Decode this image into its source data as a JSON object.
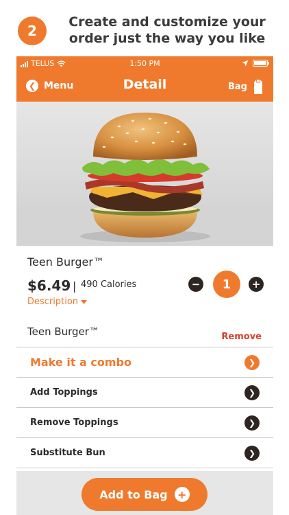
{
  "promo": {
    "step_number": "2",
    "title_line1": "Create and customize your",
    "title_line2": "order just the way you like"
  },
  "status_bar": {
    "carrier": "TELUS",
    "time": "1:50 PM"
  },
  "nav": {
    "back_label": "Menu",
    "title": "Detail",
    "bag_label": "Bag"
  },
  "product": {
    "name": "Teen Burger™",
    "price": "$6.49",
    "separator": "|",
    "calories": "490 Calories",
    "description_label": "Description",
    "quantity": "1"
  },
  "items": [
    {
      "name": "Teen Burger™",
      "remove_label": "Remove"
    }
  ],
  "options": [
    {
      "label": "Make it a combo",
      "accent": true
    },
    {
      "label": "Add Toppings"
    },
    {
      "label": "Remove Toppings"
    },
    {
      "label": "Substitute Bun"
    }
  ],
  "footer": {
    "add_button_label": "Add to Bag"
  },
  "colors": {
    "accent": "#ef7a2e",
    "dark": "#2e2420",
    "remove": "#d5402b"
  },
  "icons": [
    "signal-bars-icon",
    "wifi-icon",
    "location-arrow-icon",
    "battery-icon",
    "back-chevron-icon",
    "bag-icon",
    "minus-icon",
    "plus-icon",
    "caret-down-icon",
    "chevron-right-icon"
  ]
}
